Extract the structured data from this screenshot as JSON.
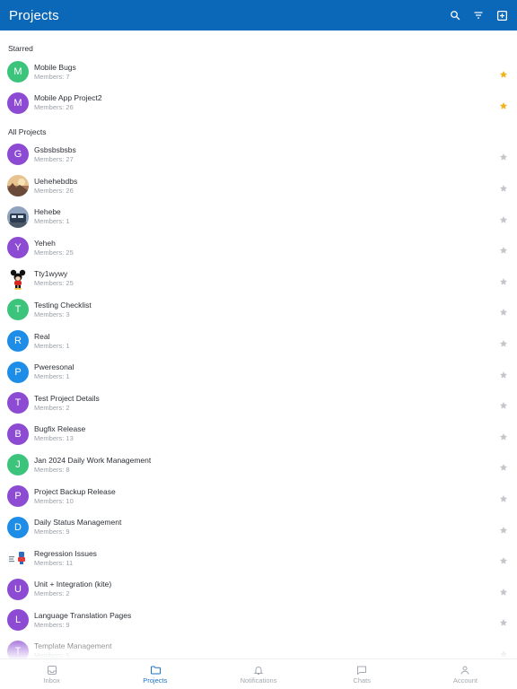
{
  "header": {
    "title": "Projects",
    "icons": [
      "search-icon",
      "filter-icon",
      "add-square-icon"
    ]
  },
  "sections": {
    "starred": "Starred",
    "all": "All Projects"
  },
  "colors": {
    "header": "#0b67b7",
    "green": "#3cc47c",
    "purple": "#8c4bd2",
    "blue": "#1e8de8",
    "star_active": "#f2b21b",
    "star_inactive": "#c3c7cc",
    "active_tab": "#1a73c9"
  },
  "starred": [
    {
      "initial": "M",
      "name": "Mobile Bugs",
      "members": "Members: 7",
      "color": "#3cc47c",
      "starred": true
    },
    {
      "initial": "M",
      "name": "Mobile App Project2",
      "members": "Members: 26",
      "color": "#8c4bd2",
      "starred": true
    }
  ],
  "projects": [
    {
      "initial": "G",
      "name": "Gsbsbsbsbs",
      "members": "Members: 27",
      "color": "#8c4bd2",
      "avatar": "letter"
    },
    {
      "initial": "",
      "name": "Uehehebdbs",
      "members": "Members: 26",
      "color": "#c9a37a",
      "avatar": "photo-sunset"
    },
    {
      "initial": "",
      "name": "Hehebe",
      "members": "Members: 1",
      "color": "#5a6f8a",
      "avatar": "photo-train"
    },
    {
      "initial": "Y",
      "name": "Yeheh",
      "members": "Members: 25",
      "color": "#8c4bd2",
      "avatar": "letter"
    },
    {
      "initial": "",
      "name": "Tty1wywy",
      "members": "Members: 25",
      "color": "#ffffff",
      "avatar": "photo-mouse"
    },
    {
      "initial": "T",
      "name": "Testing Checklist",
      "members": "Members: 3",
      "color": "#3cc47c",
      "avatar": "letter"
    },
    {
      "initial": "R",
      "name": "Real",
      "members": "Members: 1",
      "color": "#1e8de8",
      "avatar": "letter"
    },
    {
      "initial": "P",
      "name": "Pweresonal",
      "members": "Members: 1",
      "color": "#1e8de8",
      "avatar": "letter"
    },
    {
      "initial": "T",
      "name": "Test Project Details",
      "members": "Members: 2",
      "color": "#8c4bd2",
      "avatar": "letter"
    },
    {
      "initial": "B",
      "name": "Bugfix Release",
      "members": "Members: 13",
      "color": "#8c4bd2",
      "avatar": "letter"
    },
    {
      "initial": "J",
      "name": "Jan 2024 Daily Work Management",
      "members": "Members: 8",
      "color": "#3cc47c",
      "avatar": "letter"
    },
    {
      "initial": "P",
      "name": "Project Backup Release",
      "members": "Members: 10",
      "color": "#8c4bd2",
      "avatar": "letter"
    },
    {
      "initial": "D",
      "name": "Daily Status Management",
      "members": "Members: 9",
      "color": "#1e8de8",
      "avatar": "letter"
    },
    {
      "initial": "",
      "name": "Regression Issues",
      "members": "Members: 11",
      "color": "#ffffff",
      "avatar": "photo-doc"
    },
    {
      "initial": "U",
      "name": "Unit + Integration (kite)",
      "members": "Members: 2",
      "color": "#8c4bd2",
      "avatar": "letter"
    },
    {
      "initial": "L",
      "name": "Language Translation Pages",
      "members": "Members: 9",
      "color": "#8c4bd2",
      "avatar": "letter"
    },
    {
      "initial": "T",
      "name": "Template Management",
      "members": "Members: 5",
      "color": "#8c4bd2",
      "avatar": "letter"
    }
  ],
  "tabs": [
    {
      "label": "Inbox",
      "icon": "inbox-icon",
      "active": false
    },
    {
      "label": "Projects",
      "icon": "folder-icon",
      "active": true
    },
    {
      "label": "Notifications",
      "icon": "bell-icon",
      "active": false
    },
    {
      "label": "Chats",
      "icon": "chat-icon",
      "active": false
    },
    {
      "label": "Account",
      "icon": "user-icon",
      "active": false
    }
  ]
}
